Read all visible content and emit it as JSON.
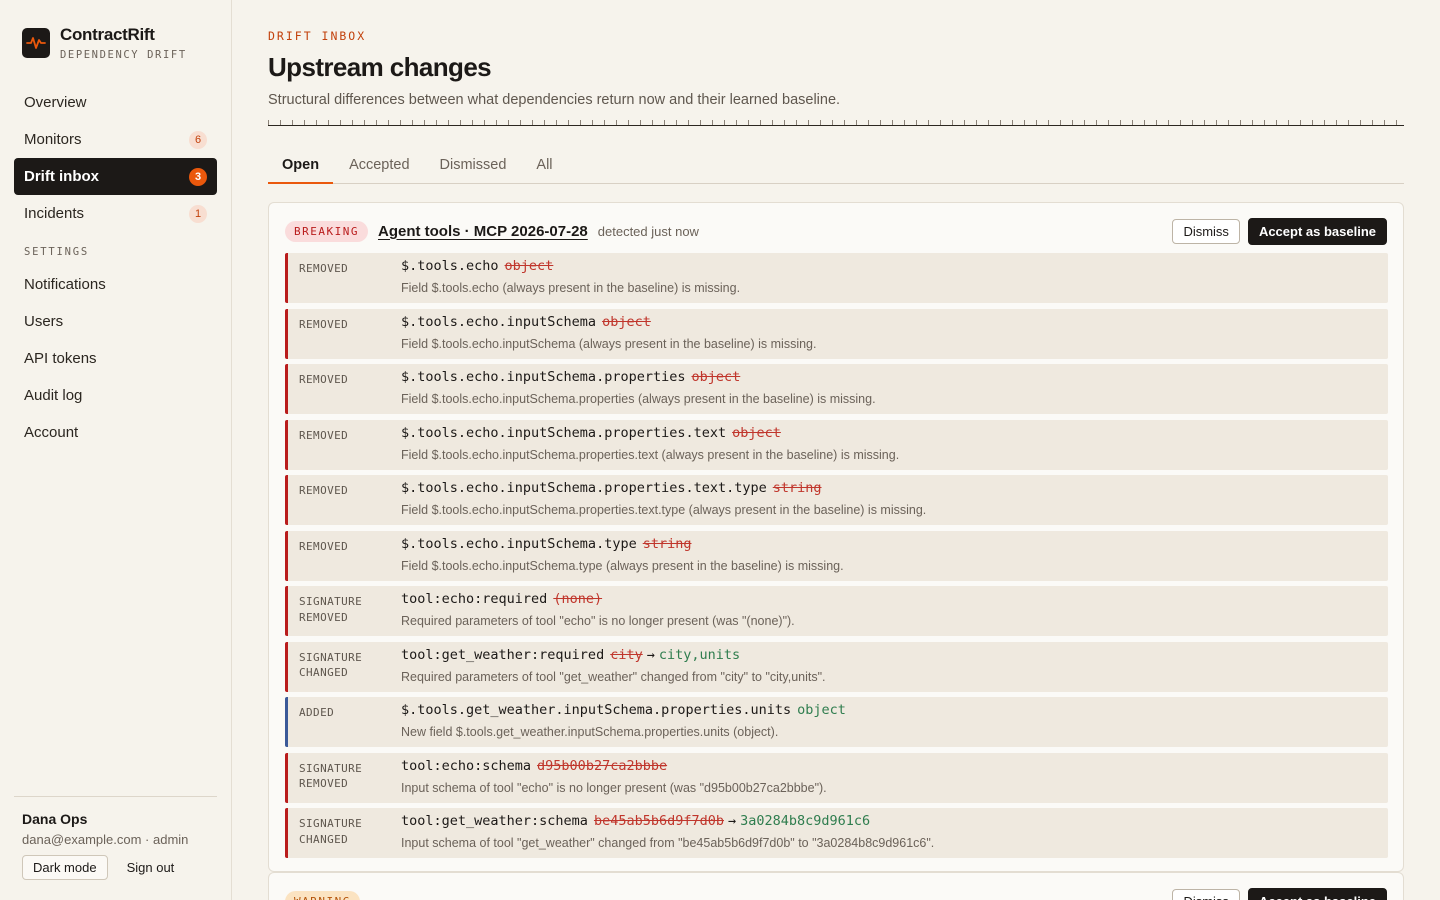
{
  "app": {
    "name": "ContractRift",
    "subtitle": "DEPENDENCY DRIFT",
    "logo_icon": "pulse-icon"
  },
  "colors": {
    "accent": "#ea580c",
    "ink": "#1c1917",
    "removed": "#b91c1c",
    "added_border": "#3b5998",
    "new_value": "#2f7d4e",
    "background": "#f6f3ec"
  },
  "nav": {
    "items": [
      {
        "label": "Overview",
        "badge": ""
      },
      {
        "label": "Monitors",
        "badge": "6"
      },
      {
        "label": "Drift inbox",
        "badge": "3",
        "active": true
      },
      {
        "label": "Incidents",
        "badge": "1"
      }
    ],
    "settings_heading": "SETTINGS",
    "settings_items": [
      {
        "label": "Notifications"
      },
      {
        "label": "Users"
      },
      {
        "label": "API tokens"
      },
      {
        "label": "Audit log"
      },
      {
        "label": "Account"
      }
    ]
  },
  "user": {
    "name": "Dana Ops",
    "meta": "dana@example.com · admin",
    "dark_mode_label": "Dark mode",
    "sign_out_label": "Sign out"
  },
  "page": {
    "eyebrow": "DRIFT INBOX",
    "title": "Upstream changes",
    "description": "Structural differences between what dependencies return now and their learned baseline."
  },
  "tabs": [
    {
      "label": "Open",
      "active": true
    },
    {
      "label": "Accepted"
    },
    {
      "label": "Dismissed"
    },
    {
      "label": "All"
    }
  ],
  "drift_card": {
    "severity": "BREAKING",
    "title": "Agent tools · MCP 2026-07-28",
    "detected": "detected just now",
    "dismiss_label": "Dismiss",
    "accept_label": "Accept as baseline",
    "changes": [
      {
        "kind_line1": "REMOVED",
        "kind_line2": "",
        "path": "$.tools.echo",
        "old": "object",
        "arrow": "",
        "new": "",
        "desc": "Field $.tools.echo (always present in the baseline) is missing."
      },
      {
        "kind_line1": "REMOVED",
        "kind_line2": "",
        "path": "$.tools.echo.inputSchema",
        "old": "object",
        "arrow": "",
        "new": "",
        "desc": "Field $.tools.echo.inputSchema (always present in the baseline) is missing."
      },
      {
        "kind_line1": "REMOVED",
        "kind_line2": "",
        "path": "$.tools.echo.inputSchema.properties",
        "old": "object",
        "arrow": "",
        "new": "",
        "desc": "Field $.tools.echo.inputSchema.properties (always present in the baseline) is missing."
      },
      {
        "kind_line1": "REMOVED",
        "kind_line2": "",
        "path": "$.tools.echo.inputSchema.properties.text",
        "old": "object",
        "arrow": "",
        "new": "",
        "desc": "Field $.tools.echo.inputSchema.properties.text (always present in the baseline) is missing."
      },
      {
        "kind_line1": "REMOVED",
        "kind_line2": "",
        "path": "$.tools.echo.inputSchema.properties.text.type",
        "old": "string",
        "arrow": "",
        "new": "",
        "desc": "Field $.tools.echo.inputSchema.properties.text.type (always present in the baseline) is missing."
      },
      {
        "kind_line1": "REMOVED",
        "kind_line2": "",
        "path": "$.tools.echo.inputSchema.type",
        "old": "string",
        "arrow": "",
        "new": "",
        "desc": "Field $.tools.echo.inputSchema.type (always present in the baseline) is missing."
      },
      {
        "kind_line1": "SIGNATURE",
        "kind_line2": "REMOVED",
        "path": "tool:echo:required",
        "old": "(none)",
        "arrow": "",
        "new": "",
        "desc": "Required parameters of tool \"echo\" is no longer present (was \"(none)\")."
      },
      {
        "kind_line1": "SIGNATURE",
        "kind_line2": "CHANGED",
        "path": "tool:get_weather:required",
        "old": "city",
        "arrow": "→",
        "new": "city,units",
        "desc": "Required parameters of tool \"get_weather\" changed from \"city\" to \"city,units\"."
      },
      {
        "kind_line1": "ADDED",
        "kind_line2": "",
        "path": "$.tools.get_weather.inputSchema.properties.units",
        "old": "",
        "arrow": "",
        "new": "object",
        "desc": "New field $.tools.get_weather.inputSchema.properties.units (object).",
        "added": true
      },
      {
        "kind_line1": "SIGNATURE",
        "kind_line2": "REMOVED",
        "path": "tool:echo:schema",
        "old": "d95b00b27ca2bbbe",
        "arrow": "",
        "new": "",
        "desc": "Input schema of tool \"echo\" is no longer present (was \"d95b00b27ca2bbbe\")."
      },
      {
        "kind_line1": "SIGNATURE",
        "kind_line2": "CHANGED",
        "path": "tool:get_weather:schema",
        "old": "be45ab5b6d9f7d0b",
        "arrow": "→",
        "new": "3a0284b8c9d961c6",
        "desc": "Input schema of tool \"get_weather\" changed from \"be45ab5b6d9f7d0b\" to \"3a0284b8c9d961c6\"."
      }
    ]
  },
  "next_card": {
    "severity": "WARNING",
    "dismiss_label": "Dismiss",
    "accept_label": "Accept as baseline"
  }
}
